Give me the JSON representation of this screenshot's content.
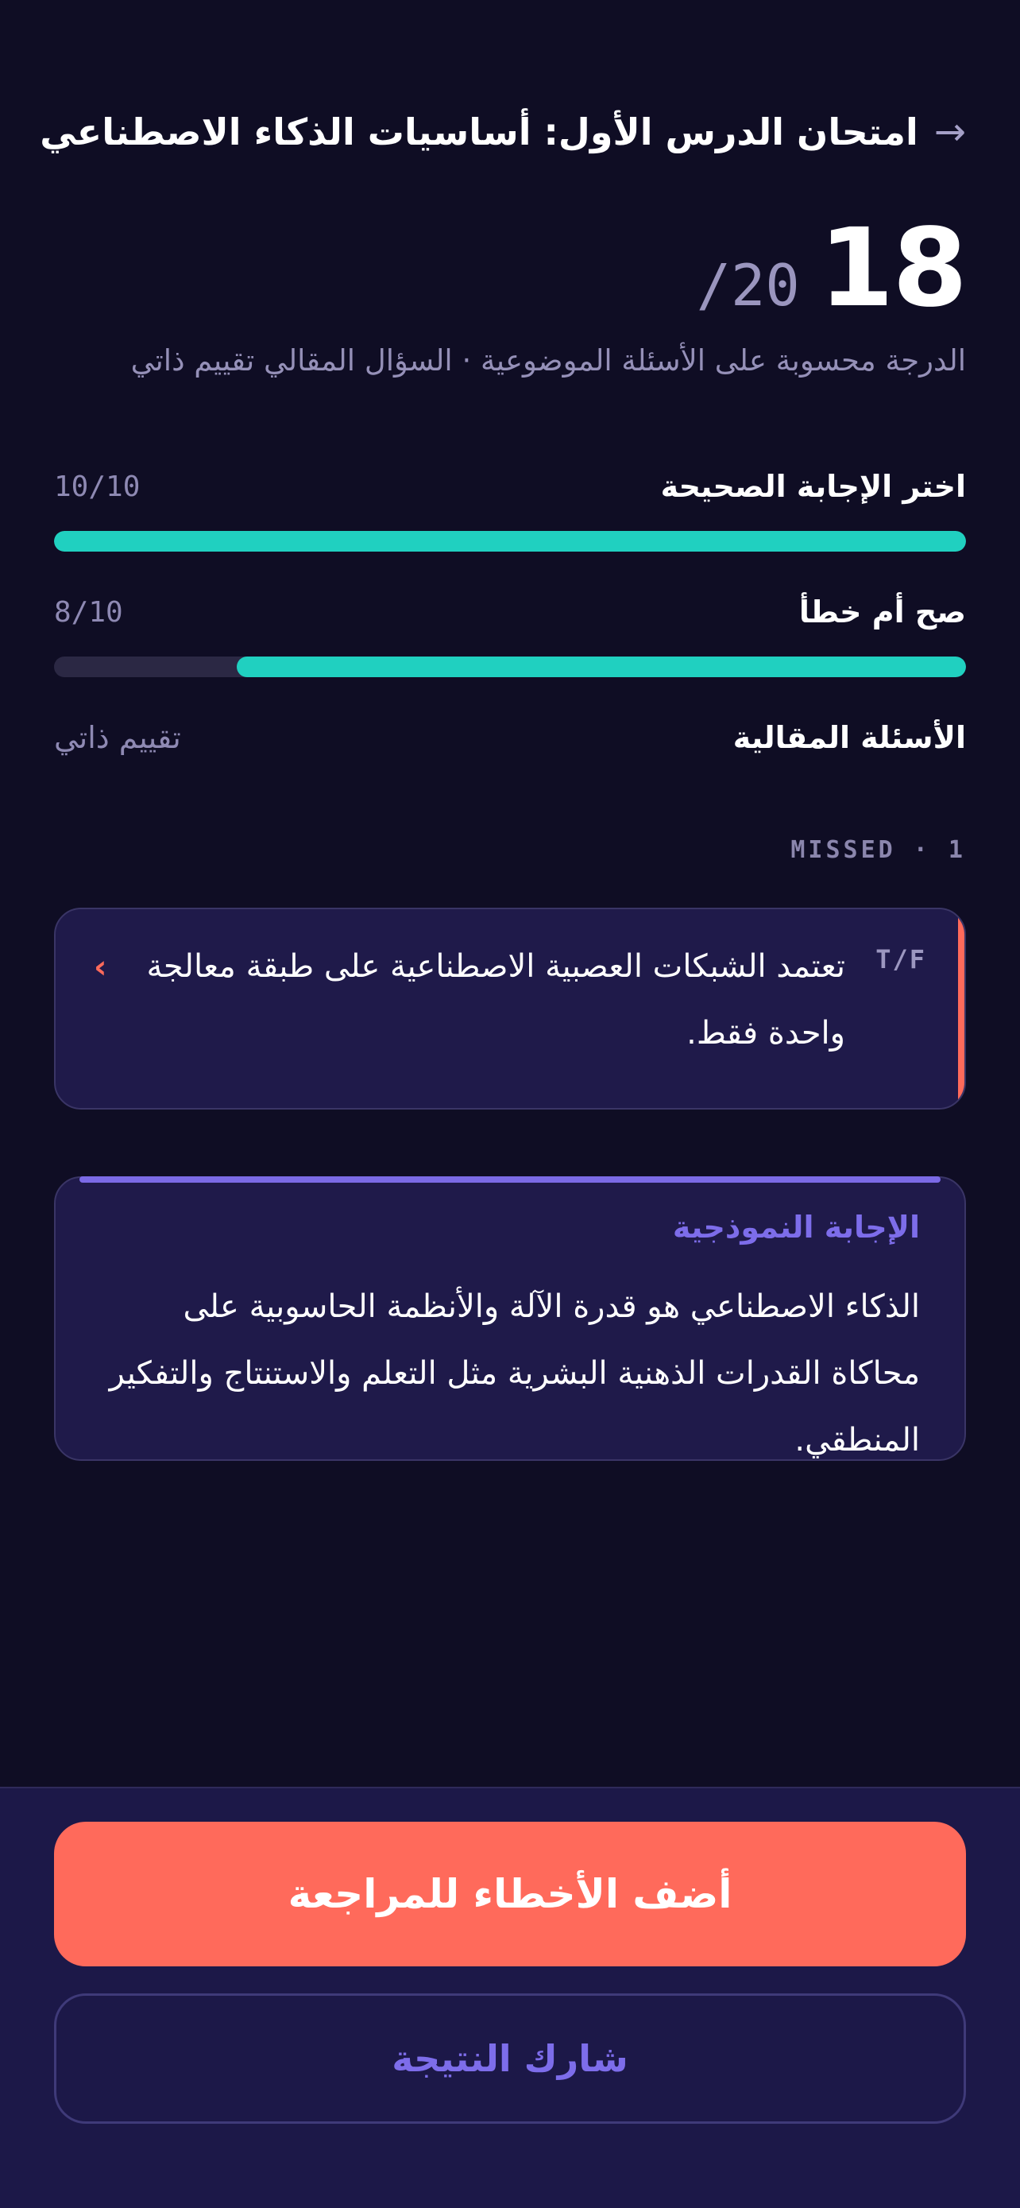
{
  "header": {
    "back_icon": "arrow-right-icon",
    "back_glyph": "→",
    "title": "امتحان الدرس الأول: أساسيات الذكاء الاصطناعي"
  },
  "score": {
    "value": "18",
    "total": "/20",
    "note": "الدرجة محسوبة على الأسئلة الموضوعية · السؤال المقالي تقييم ذاتي"
  },
  "breakdown": [
    {
      "label": "اختر الإجابة الصحيحة",
      "value": "10/10",
      "fraction": 1.0
    },
    {
      "label": "صح أم خطأ",
      "value": "8/10",
      "fraction": 0.8
    },
    {
      "label": "الأسئلة المقالية",
      "value": "تقييم ذاتي"
    }
  ],
  "missed": {
    "header": "MISSED · 1",
    "items": [
      {
        "tag": "T/F",
        "text": "تعتمد الشبكات العصبية الاصطناعية على طبقة معالجة واحدة فقط.",
        "chevron_glyph": "‹"
      }
    ]
  },
  "model_answer": {
    "title": "الإجابة النموذجية",
    "text": "الذكاء الاصطناعي هو قدرة الآلة والأنظمة الحاسوبية على محاكاة القدرات الذهنية البشرية مثل التعلم والاستنتاج والتفكير المنطقي."
  },
  "actions": {
    "primary_label": "أضف الأخطاء للمراجعة",
    "secondary_label": "شارك النتيجة"
  },
  "colors": {
    "background": "#0f0d24",
    "card": "#1f1a4a",
    "accent_teal": "#20d0c0",
    "accent_coral": "#ff6a5b",
    "accent_purple": "#7d6dea"
  }
}
